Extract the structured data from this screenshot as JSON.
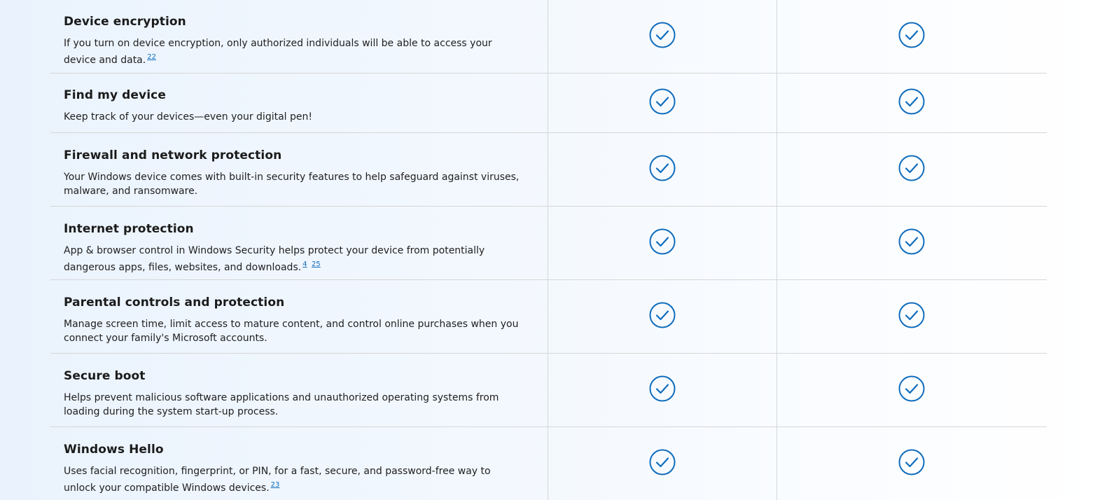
{
  "colors": {
    "check": "#0f6cbd",
    "divider": "#d6d6d6",
    "link": "#0f6cbd"
  },
  "columns": [
    "plan-a",
    "plan-b"
  ],
  "rows": [
    {
      "title": "Device encryption",
      "description": "If you turn on device encryption, only authorized individuals will be able to access your device and data.",
      "footnotes": [
        "22"
      ],
      "plan_a": true,
      "plan_b": true
    },
    {
      "title": "Find my device",
      "description": "Keep track of your devices—even your digital pen!",
      "footnotes": [],
      "plan_a": true,
      "plan_b": true
    },
    {
      "title": "Firewall and network protection",
      "description": "Your Windows device comes with built-in security features to help safeguard against viruses, malware, and ransomware.",
      "footnotes": [],
      "plan_a": true,
      "plan_b": true
    },
    {
      "title": "Internet protection",
      "description": "App & browser control in Windows Security helps protect your device from potentially dangerous apps, files, websites, and downloads.",
      "footnotes": [
        "4",
        "25"
      ],
      "plan_a": true,
      "plan_b": true
    },
    {
      "title": "Parental controls and protection",
      "description": "Manage screen time, limit access to mature content, and control online purchases when you connect your family's Microsoft accounts.",
      "footnotes": [],
      "plan_a": true,
      "plan_b": true
    },
    {
      "title": "Secure boot",
      "description": "Helps prevent malicious software applications and unauthorized operating systems from loading during the system start-up process.",
      "footnotes": [],
      "plan_a": true,
      "plan_b": true
    },
    {
      "title": "Windows Hello",
      "description": "Uses facial recognition, fingerprint, or PIN, for a fast, secure, and password-free way to unlock your compatible Windows devices.",
      "footnotes": [
        "23"
      ],
      "plan_a": true,
      "plan_b": true
    }
  ]
}
